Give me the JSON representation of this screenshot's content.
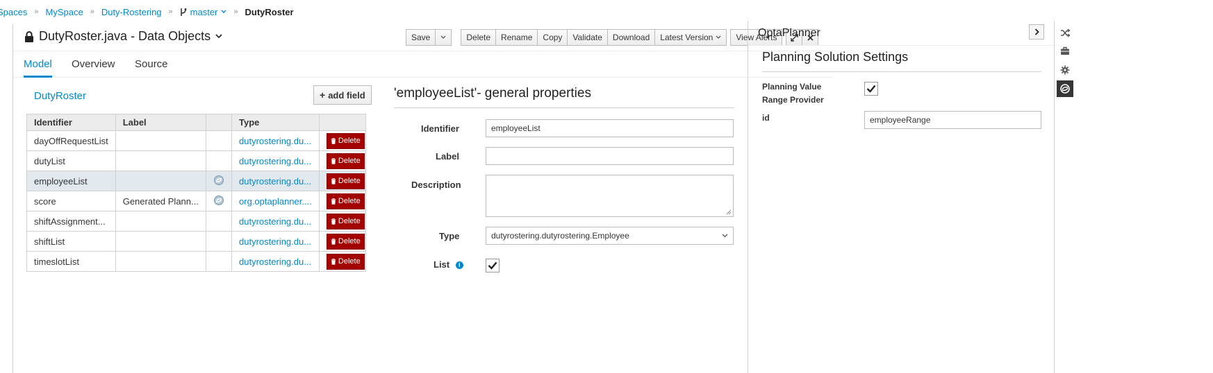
{
  "breadcrumb": {
    "items": [
      "Spaces",
      "MySpace",
      "Duty-Rostering"
    ],
    "branch": "master",
    "current": "DutyRoster",
    "separator": "»"
  },
  "editor": {
    "title": "DutyRoster.java - Data Objects",
    "toolbar": {
      "save": "Save",
      "delete": "Delete",
      "rename": "Rename",
      "copy": "Copy",
      "validate": "Validate",
      "download": "Download",
      "latest_version": "Latest Version",
      "view_alerts": "View Alerts"
    },
    "tabs": [
      "Model",
      "Overview",
      "Source"
    ],
    "active_tab": "Model"
  },
  "object": {
    "name": "DutyRoster",
    "add_field": "add field",
    "columns": [
      "Identifier",
      "Label",
      "",
      "Type",
      ""
    ],
    "delete_label": "Delete",
    "rows": [
      {
        "identifier": "dayOffRequestList",
        "label": "",
        "planning": false,
        "type": "dutyrostering.du..."
      },
      {
        "identifier": "dutyList",
        "label": "",
        "planning": false,
        "type": "dutyrostering.du..."
      },
      {
        "identifier": "employeeList",
        "label": "",
        "planning": true,
        "type": "dutyrostering.du...",
        "selected": true
      },
      {
        "identifier": "score",
        "label": "Generated Plann...",
        "planning": true,
        "type": "org.optaplanner...."
      },
      {
        "identifier": "shiftAssignment...",
        "label": "",
        "planning": false,
        "type": "dutyrostering.du..."
      },
      {
        "identifier": "shiftList",
        "label": "",
        "planning": false,
        "type": "dutyrostering.du..."
      },
      {
        "identifier": "timeslotList",
        "label": "",
        "planning": false,
        "type": "dutyrostering.du..."
      }
    ]
  },
  "properties": {
    "title": "'employeeList'- general properties",
    "identifier_label": "Identifier",
    "identifier_value": "employeeList",
    "label_label": "Label",
    "label_value": "",
    "description_label": "Description",
    "description_value": "",
    "type_label": "Type",
    "type_value": "dutyrostering.dutyrostering.Employee",
    "list_label": "List",
    "list_checked": true
  },
  "planner": {
    "title": "OptaPlanner",
    "settings_title": "Planning Solution Settings",
    "value_range_label_line1": "Planning Value",
    "value_range_label_line2": "Range Provider",
    "value_range_checked": true,
    "id_label": "id",
    "id_value": "employeeRange"
  },
  "side_icons": [
    "shuffle-icon",
    "briefcase-icon",
    "gear-icon",
    "optaplanner-icon"
  ],
  "colors": {
    "link": "#0088ce",
    "delete": "#a30000",
    "selected_row": "#e1e8ee",
    "header_bg": "#ececec"
  }
}
